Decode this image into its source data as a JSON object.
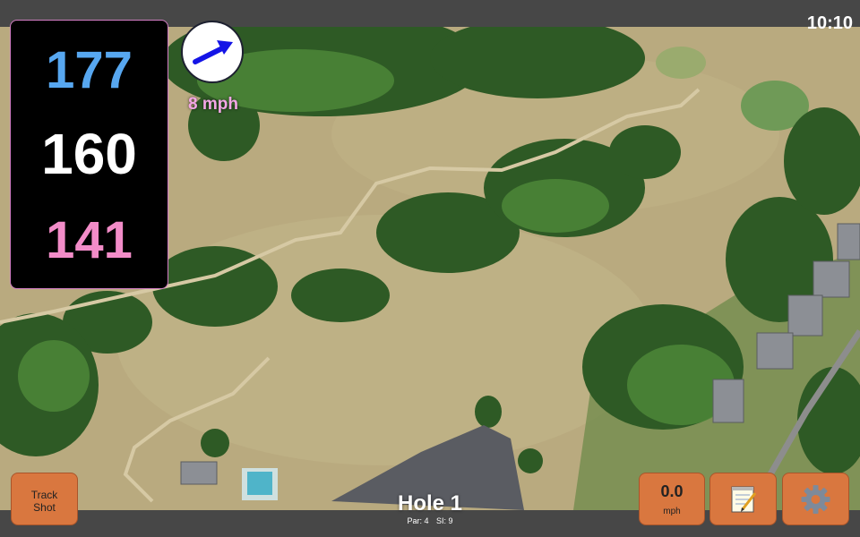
{
  "status": {
    "time": "10:10"
  },
  "distances": {
    "back": "177",
    "center": "160",
    "front": "141"
  },
  "wind": {
    "speed_text": "8 mph",
    "direction_icon": "arrow-northeast-icon"
  },
  "hole": {
    "title": "Hole 1",
    "par_label": "Par: 4",
    "si_label": "SI: 9"
  },
  "buttons": {
    "track_shot": {
      "line1": "Track",
      "line2": "Shot"
    },
    "speed": {
      "value": "0.0",
      "unit": "mph"
    },
    "notes_icon": "notepad-icon",
    "settings_icon": "gear-icon"
  },
  "colors": {
    "back_distance": "#57a7f0",
    "center_distance": "#ffffff",
    "front_distance": "#f28cc8",
    "wind_text": "#f3a6e6",
    "button_bg": "#d9773f"
  }
}
